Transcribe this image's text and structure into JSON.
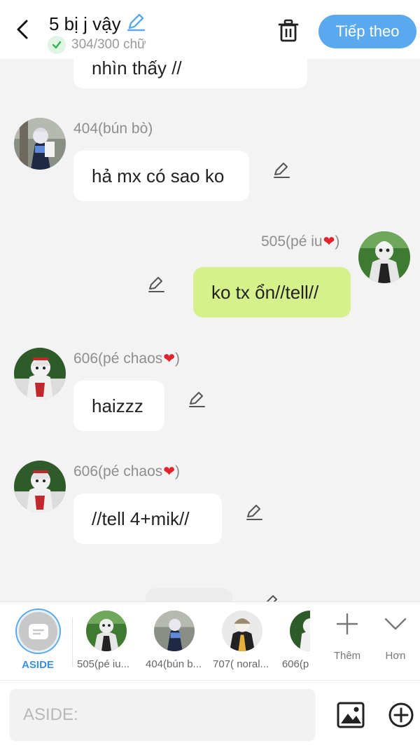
{
  "header": {
    "title": "5 bị j vậy",
    "word_count": "304/300 chữ",
    "next_label": "Tiếp theo"
  },
  "messages": [
    {
      "text": "nhìn thấy //"
    },
    {
      "name": "404(bún bò)",
      "text": "hả mx có sao ko"
    },
    {
      "name": "505(pé iu",
      "text": "ko tx ổn//tell//"
    },
    {
      "name": "606(pé chaos",
      "text": "haizzz"
    },
    {
      "name": "606(pé chaos",
      "text": "//tell 4+mik//"
    }
  ],
  "name_suffix": ")",
  "characters": [
    {
      "label": "ASIDE"
    },
    {
      "label": "505(pé iu..."
    },
    {
      "label": "404(bún b..."
    },
    {
      "label": "707( noral..."
    },
    {
      "label": "606(p"
    }
  ],
  "tools": {
    "more_label": "Thêm",
    "collapse_label": "Hơn"
  },
  "input": {
    "placeholder": "ASIDE:"
  },
  "colors": {
    "accent": "#5aa9ef",
    "mine_bubble": "#d6f08c",
    "heart": "#e0242e"
  }
}
